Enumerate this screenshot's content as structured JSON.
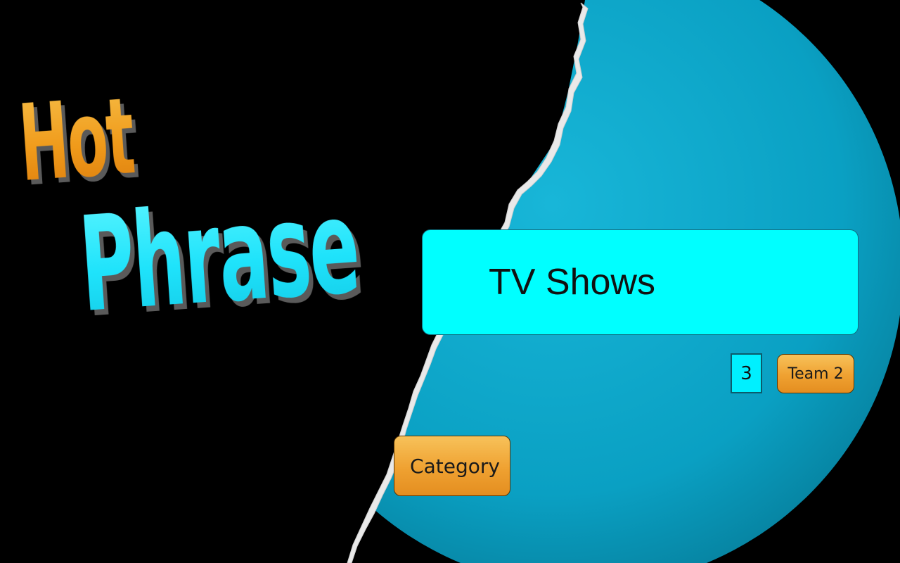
{
  "logo": {
    "line1": "Hot",
    "line2": "Phrase"
  },
  "game": {
    "phrase": "TV Shows",
    "score": "3",
    "team_label": "Team 2",
    "category_label": "Category"
  },
  "colors": {
    "background": "#000000",
    "circle": "#0aa3c6",
    "phrase_box": "#00ffff",
    "button": "#efa131",
    "logo_hot": "#f2a21f",
    "logo_phrase": "#23e7fb",
    "torn_edge": "#e8e8e8"
  }
}
